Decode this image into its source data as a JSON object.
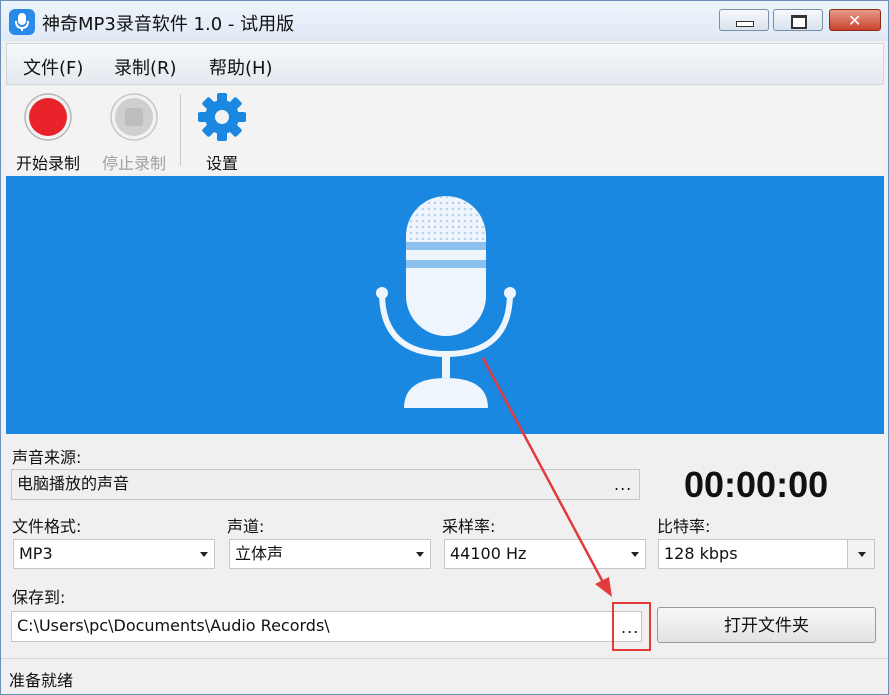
{
  "window": {
    "title": "神奇MP3录音软件 1.0 - 试用版",
    "close_glyph": "✕"
  },
  "menu": [
    {
      "label": "文件(F)"
    },
    {
      "label": "录制(R)"
    },
    {
      "label": "帮助(H)"
    }
  ],
  "toolbar": {
    "start_label": "开始录制",
    "stop_label": "停止录制",
    "settings_label": "设置"
  },
  "form": {
    "source_label": "声音来源:",
    "source_value": "电脑播放的声音",
    "browse_dots": "...",
    "timer": "00:00:00",
    "format_label": "文件格式:",
    "format_value": "MP3",
    "channel_label": "声道:",
    "channel_value": "立体声",
    "samplerate_label": "采样率:",
    "samplerate_value": "44100 Hz",
    "bitrate_label": "比特率:",
    "bitrate_value": "128 kbps",
    "saveto_label": "保存到:",
    "saveto_value": "C:\\Users\\pc\\Documents\\Audio Records\\",
    "open_folder_label": "打开文件夹"
  },
  "status": {
    "text": "准备就绪"
  },
  "colors": {
    "panel_blue": "#1a87e0",
    "record_red": "#e8232a",
    "settings_blue": "#1a87e0",
    "annotation_red": "#e23b3b"
  }
}
